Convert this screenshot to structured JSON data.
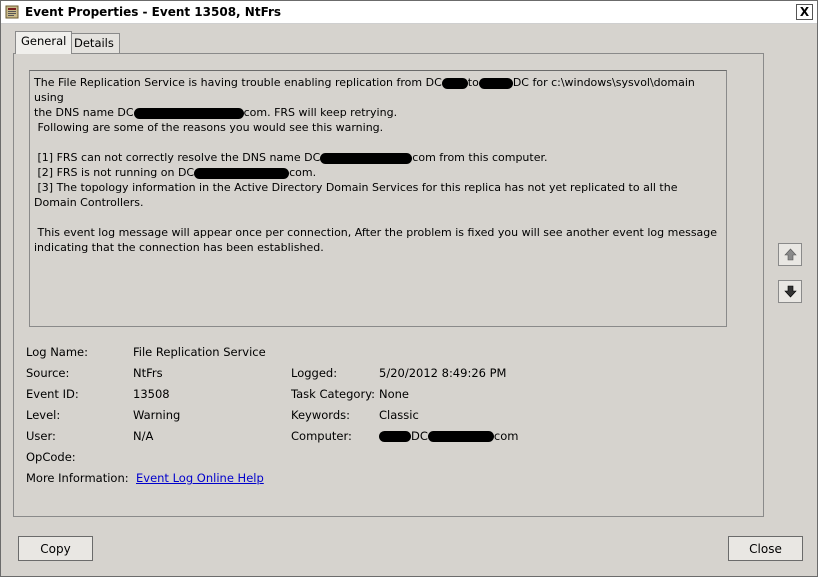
{
  "window": {
    "title": "Event Properties - Event 13508, NtFrs",
    "close_glyph": "X"
  },
  "tabs": [
    {
      "label": "General",
      "active": true
    },
    {
      "label": "Details",
      "active": false
    }
  ],
  "description": {
    "line1": "The File Replication Service is having trouble enabling replication from DC",
    "line1b": "to",
    "line1c": "DC for c:\\windows\\sysvol\\domain using",
    "line2a": "the DNS name DC",
    "line2b": "com. FRS will keep retrying.",
    "line3": " Following are some of the reasons you would see this warning.",
    "reason1a": " [1] FRS can not correctly resolve the DNS name DC",
    "reason1b": "com from this computer.",
    "reason2a": " [2] FRS is not running on DC",
    "reason2b": "com.",
    "reason3": " [3] The topology information in the Active Directory Domain Services for this replica has not yet replicated to all the Domain Controllers.",
    "closing": " This event log message will appear once per connection, After the problem is fixed you will see another event log message indicating that the connection has been established."
  },
  "fields": {
    "log_name_label": "Log Name:",
    "log_name": "File Replication Service",
    "source_label": "Source:",
    "source": "NtFrs",
    "logged_label": "Logged:",
    "logged": "5/20/2012 8:49:26 PM",
    "event_id_label": "Event ID:",
    "event_id": "13508",
    "task_category_label": "Task Category:",
    "task_category": "None",
    "level_label": "Level:",
    "level": "Warning",
    "keywords_label": "Keywords:",
    "keywords": "Classic",
    "user_label": "User:",
    "user": "N/A",
    "computer_label": "Computer:",
    "computer_a": "DC",
    "computer_b": "com",
    "opcode_label": "OpCode:",
    "more_info_label": "More Information:",
    "more_info_link": "Event Log Online Help"
  },
  "buttons": {
    "copy": "Copy",
    "close": "Close"
  },
  "icons": {
    "title": "event-viewer-icon",
    "up": "arrow-up-icon",
    "down": "arrow-down-icon"
  }
}
